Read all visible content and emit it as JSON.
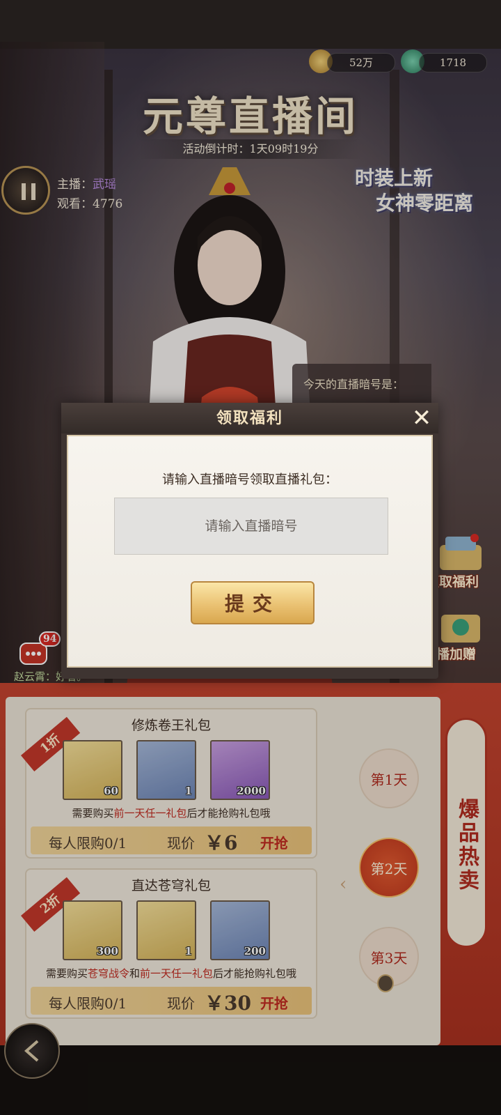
{
  "currency": {
    "coins": "52万",
    "jade": "1718"
  },
  "header": {
    "title": "元尊直播间",
    "countdown": "活动倒计时：1天09时19分"
  },
  "host": {
    "host_label": "主播：",
    "host_name": "武瑶",
    "viewers_label": "观看：",
    "viewers": "4776"
  },
  "slogan": {
    "line1": "时装上新",
    "line2": "女神零距离"
  },
  "code_hint": "今天的直播暗号是：",
  "side": {
    "claim_label": "领取福利",
    "gift_label": "直播加赠"
  },
  "chat": {
    "badge": "94",
    "message": "赵云霄：好看。"
  },
  "modal": {
    "title": "领取福利",
    "prompt": "请输入直播暗号领取直播礼包：",
    "input_placeholder": "请输入直播暗号",
    "input_value": "",
    "submit_label": "提交"
  },
  "gifts": [
    {
      "discount": "1折",
      "title": "修炼卷王礼包",
      "items": [
        {
          "icon": "jade-dragon-icon",
          "qty": "60"
        },
        {
          "icon": "brush-icon",
          "qty": "1"
        },
        {
          "icon": "purple-crystal-icon",
          "qty": "2000"
        }
      ],
      "note_prefix": "需要购买",
      "note_highlight": "前一天任一礼包",
      "note_suffix": "后才能抢购礼包哦",
      "limit": "每人限购0/1",
      "price_label": "现价",
      "price": "￥6",
      "buy_label": "开抢"
    },
    {
      "discount": "2折",
      "title": "直达苍穹礼包",
      "items": [
        {
          "icon": "jade-dragon-icon",
          "qty": "300"
        },
        {
          "icon": "treasure-chest-icon",
          "qty": "1"
        },
        {
          "icon": "potion-bottle-icon",
          "qty": "200"
        }
      ],
      "note_prefix": "需要购买",
      "note_highlight": "苍穹战令",
      "note_mid": "和",
      "note_highlight2": "前一天任一礼包",
      "note_suffix": "后才能抢购礼包哦",
      "limit": "每人限购0/1",
      "price_label": "现价",
      "price": "￥30",
      "buy_label": "开抢"
    }
  ],
  "days": [
    "第1天",
    "第2天",
    "第3天"
  ],
  "hot_banner": "爆品热卖",
  "colors": {
    "accent_red": "#c2382a",
    "gold": "#eac273",
    "highlight_text": "#c02a20"
  }
}
